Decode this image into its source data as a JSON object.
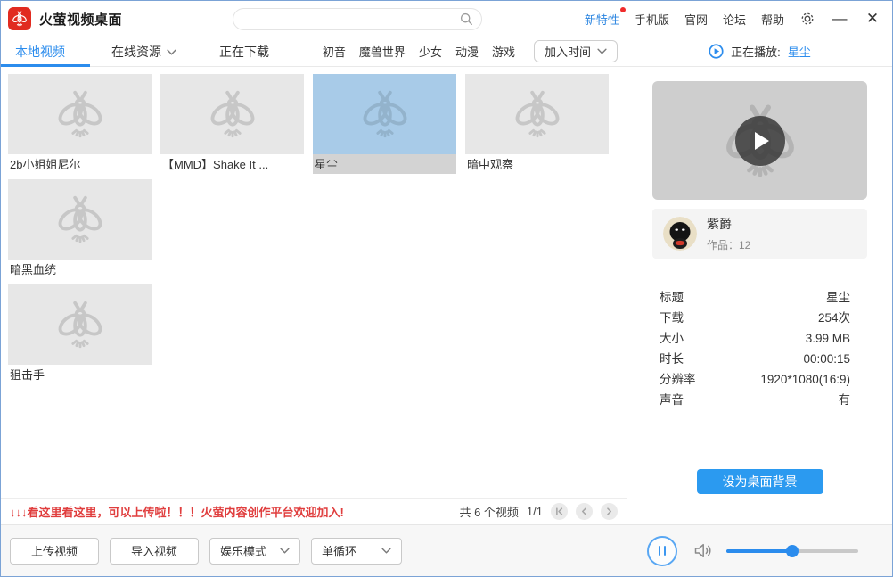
{
  "colors": {
    "accent": "#2b8ced",
    "logo_red": "#e12b20",
    "notice_red": "#e03e3e",
    "selected_thumb": "#a8cbe8"
  },
  "titlebar": {
    "app_title": "火萤视频桌面",
    "search_placeholder": "",
    "links": [
      {
        "label": "新特性"
      },
      {
        "label": "手机版"
      },
      {
        "label": "官网"
      },
      {
        "label": "论坛"
      },
      {
        "label": "帮助"
      }
    ],
    "minimize": "—",
    "close": "✕"
  },
  "tabs": [
    {
      "label": "本地视频",
      "active": true
    },
    {
      "label": "在线资源",
      "has_dropdown": true
    },
    {
      "label": "正在下载"
    }
  ],
  "categories": [
    "初音",
    "魔兽世界",
    "少女",
    "动漫",
    "游戏"
  ],
  "sort_dropdown": {
    "value": "加入时间"
  },
  "videos": {
    "cards": [
      {
        "title": "2b小姐姐尼尔",
        "selected": false
      },
      {
        "title": "【MMD】Shake It ...",
        "selected": false
      },
      {
        "title": "星尘",
        "selected": true
      },
      {
        "title": "暗中观察",
        "selected": false
      },
      {
        "title": "暗黑血统",
        "selected": false
      },
      {
        "title": "狙击手",
        "selected": false
      }
    ],
    "notice": "↓↓↓看这里看这里，可以上传啦！！！火萤内容创作平台欢迎加入!",
    "count_text": "共 6 个视频",
    "page_indicator": "1/1"
  },
  "player": {
    "now_playing_label": "正在播放:",
    "now_playing_title": "星尘",
    "author": {
      "name": "紫爵",
      "works": "作品：12"
    },
    "details": [
      {
        "label": "标题",
        "value": "星尘"
      },
      {
        "label": "下载",
        "value": "254次"
      },
      {
        "label": "大小",
        "value": "3.99 MB"
      },
      {
        "label": "时长",
        "value": "00:00:15"
      },
      {
        "label": "分辨率",
        "value": "1920*1080(16:9)"
      },
      {
        "label": "声音",
        "value": "有"
      }
    ],
    "set_wallpaper_button": "设为桌面背景",
    "volume_percent": 50
  },
  "bottombar": {
    "upload_button": "上传视频",
    "import_button": "导入视频",
    "mode_dropdown": "娱乐模式",
    "loop_dropdown": "单循环"
  }
}
